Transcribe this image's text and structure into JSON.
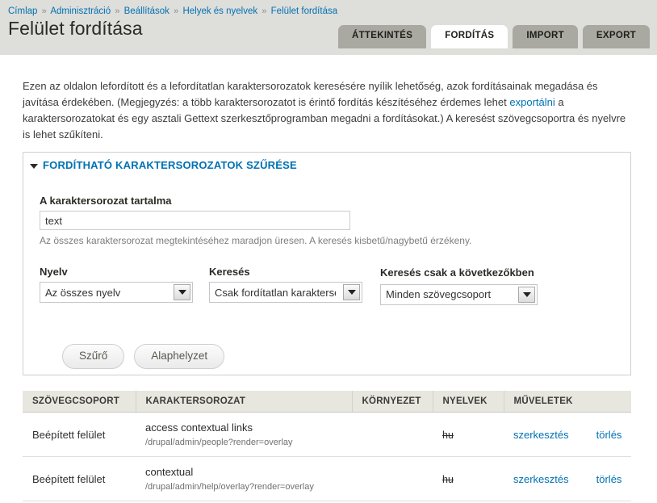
{
  "breadcrumb": {
    "separator": "»",
    "items": [
      {
        "label": "Címlap"
      },
      {
        "label": "Adminisztráció"
      },
      {
        "label": "Beállítások"
      },
      {
        "label": "Helyek és nyelvek"
      },
      {
        "label": "Felület fordítása"
      }
    ]
  },
  "header": {
    "title": "Felület fordítása"
  },
  "tabs": [
    {
      "label": "ÁTTEKINTÉS",
      "active": false
    },
    {
      "label": "FORDÍTÁS",
      "active": true
    },
    {
      "label": "IMPORT",
      "active": false
    },
    {
      "label": "EXPORT",
      "active": false
    }
  ],
  "intro": {
    "part1": "Ezen az oldalon lefordított és a lefordítatlan karaktersorozatok keresésére nyílik lehetőség, azok fordításainak megadása és javítása érdekében. (Megjegyzés: a több karaktersorozatot is érintő fordítás készítéséhez érdemes lehet ",
    "link": "exportálni",
    "part2": " a karaktersorozatokat és egy asztali Gettext szerkesztőprogramban megadni a fordításokat.) A keresést szövegcsoportra és nyelvre is lehet szűkíteni."
  },
  "filter": {
    "legend": "FORDÍTHATÓ KARAKTERSOROZATOK SZŰRÉSE",
    "caret_icon": "caret-down-icon",
    "string_field": {
      "label": "A karaktersorozat tartalma",
      "value": "text",
      "placeholder": "",
      "description": "Az összes karaktersorozat megtekintéséhez maradjon üresen. A keresés kisbetű/nagybetű érzékeny."
    },
    "language_select": {
      "label": "Nyelv",
      "value": "Az összes nyelv",
      "options": [
        "Az összes nyelv"
      ]
    },
    "search_select": {
      "label": "Keresés",
      "value": "Csak fordítatlan karaktersorozatok",
      "options": [
        "Csak fordítatlan karaktersorozatok"
      ]
    },
    "group_select": {
      "label": "Keresés csak a következőkben",
      "value": "Minden szövegcsoport",
      "options": [
        "Minden szövegcsoport"
      ]
    },
    "submit_button": "Szűrő",
    "reset_button": "Alaphelyzet"
  },
  "table": {
    "columns": [
      "SZÖVEGCSOPORT",
      "KARAKTERSOROZAT",
      "KÖRNYEZET",
      "NYELVEK",
      "MŰVELETEK"
    ],
    "rows": [
      {
        "group": "Beépített felület",
        "string": "access contextual links",
        "location": "/drupal/admin/people?render=overlay",
        "context": "",
        "languages": "hu",
        "edit_label": "szerkesztés",
        "delete_label": "törlés"
      },
      {
        "group": "Beépített felület",
        "string": "contextual",
        "location": "/drupal/admin/help/overlay?render=overlay",
        "context": "",
        "languages": "hu",
        "edit_label": "szerkesztés",
        "delete_label": "törlés"
      }
    ]
  },
  "colors": {
    "link": "#0071b3",
    "header_bg": "#dededa",
    "tab_inactive": "#a9a9a2",
    "table_header_bg": "#e7e7e0"
  }
}
